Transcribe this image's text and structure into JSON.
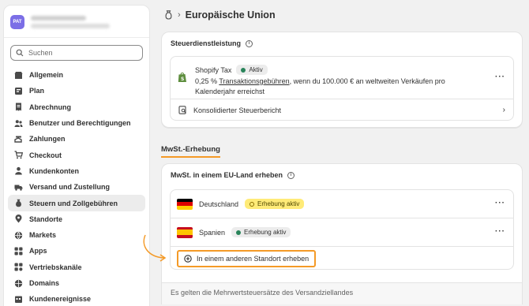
{
  "store": {
    "avatar_initials": "PAT"
  },
  "search": {
    "placeholder": "Suchen"
  },
  "sidebar": {
    "items": [
      {
        "label": "Allgemein",
        "icon": "store-icon"
      },
      {
        "label": "Plan",
        "icon": "plan-icon"
      },
      {
        "label": "Abrechnung",
        "icon": "billing-icon"
      },
      {
        "label": "Benutzer und Berechtigungen",
        "icon": "users-icon"
      },
      {
        "label": "Zahlungen",
        "icon": "payments-icon"
      },
      {
        "label": "Checkout",
        "icon": "cart-icon"
      },
      {
        "label": "Kundenkonten",
        "icon": "person-icon"
      },
      {
        "label": "Versand und Zustellung",
        "icon": "truck-icon"
      },
      {
        "label": "Steuern und Zollgebühren",
        "icon": "tax-icon",
        "active": true
      },
      {
        "label": "Standorte",
        "icon": "location-icon"
      },
      {
        "label": "Markets",
        "icon": "globe-icon"
      },
      {
        "label": "Apps",
        "icon": "apps-icon"
      },
      {
        "label": "Vertriebskanäle",
        "icon": "channels-icon"
      },
      {
        "label": "Domains",
        "icon": "domain-icon"
      },
      {
        "label": "Kundenereignisse",
        "icon": "events-icon"
      }
    ]
  },
  "header": {
    "breadcrumb_icon": "tax-icon",
    "title": "Europäische Union"
  },
  "tax_service": {
    "title": "Steuerdienstleistung",
    "name": "Shopify Tax",
    "status": "Aktiv",
    "desc_prefix": "0,25 % ",
    "desc_link": "Transaktionsgebühren",
    "desc_suffix": ", wenn du 100.000 € an weltweiten Verkäufen pro Kalenderjahr erreichst",
    "report_label": "Konsolidierter Steuerbericht"
  },
  "vat": {
    "section_title": "MwSt.-Erhebung",
    "card_title": "MwSt. in einem EU-Land erheben",
    "countries": [
      {
        "name": "Deutschland",
        "status": "Erhebung aktiv"
      },
      {
        "name": "Spanien",
        "status": "Erhebung aktiv"
      }
    ],
    "add_button": "In einem anderen Standort erheben",
    "footer": "Es gelten die Mehrwertsteuersätze des Versandziellandes"
  },
  "colors": {
    "accent": "#f49a27",
    "success": "#29845a",
    "warning_bg": "#ffeb78",
    "avatar": "#7b6ee6"
  }
}
